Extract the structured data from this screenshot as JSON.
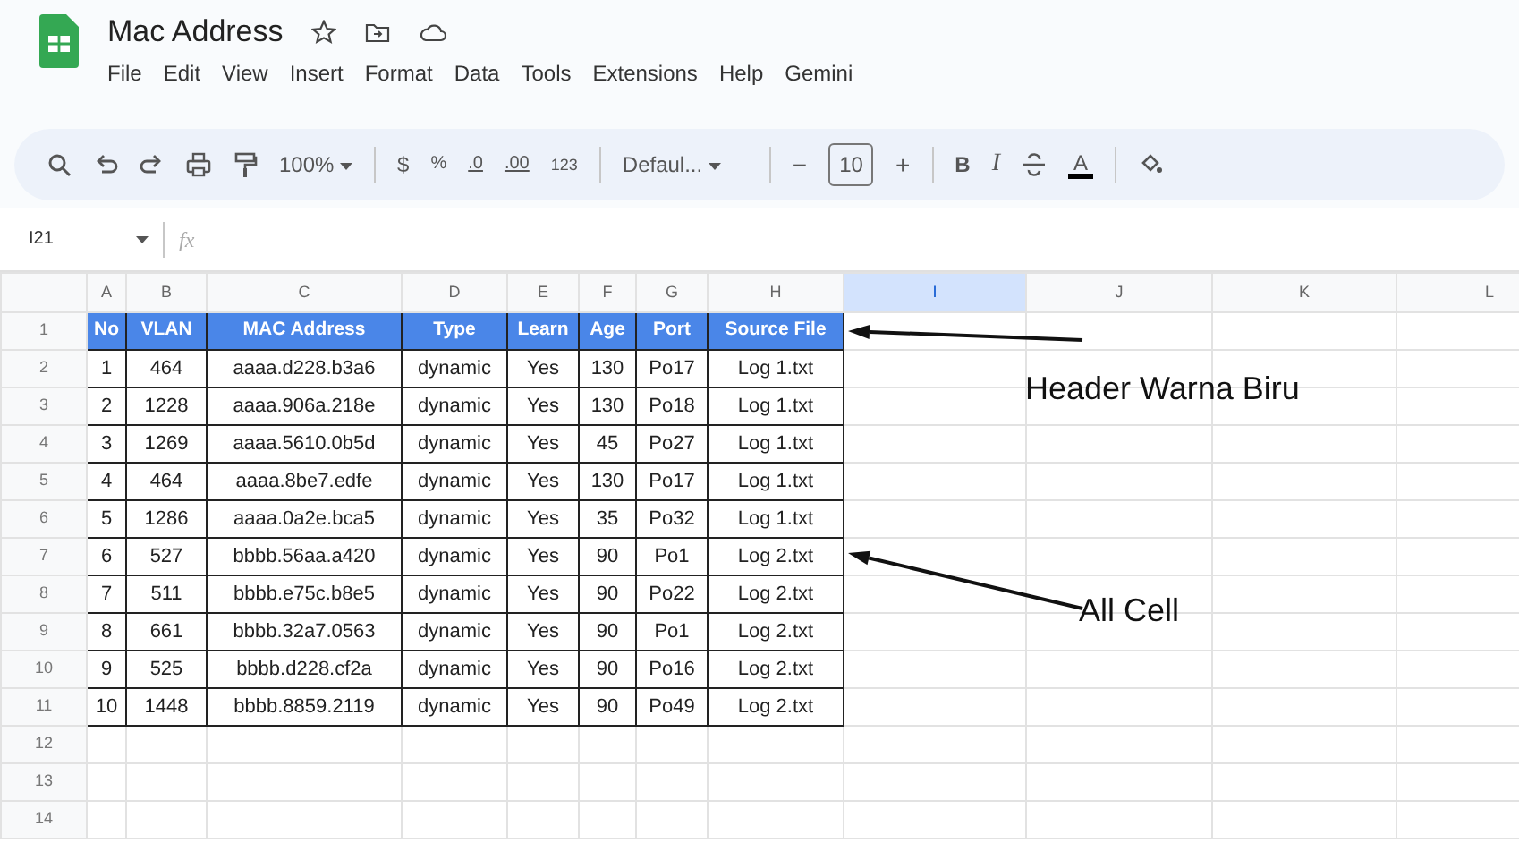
{
  "app": {
    "title": "Mac Address",
    "menu": [
      "File",
      "Edit",
      "View",
      "Insert",
      "Format",
      "Data",
      "Tools",
      "Extensions",
      "Help",
      "Gemini"
    ]
  },
  "toolbar": {
    "zoom": "100%",
    "currency": "$",
    "percent": "%",
    "decrease_decimal": ".0",
    "increase_decimal": ".00",
    "number_format": "123",
    "font": "Defaul...",
    "minus": "−",
    "font_size": "10",
    "plus": "+",
    "bold": "B",
    "italic": "I",
    "text_color": "A"
  },
  "formula_bar": {
    "cell_ref": "I21",
    "fx": "fx"
  },
  "sheet": {
    "columns": [
      {
        "label": "A",
        "selected": false
      },
      {
        "label": "B",
        "selected": false
      },
      {
        "label": "C",
        "selected": false
      },
      {
        "label": "D",
        "selected": false
      },
      {
        "label": "E",
        "selected": false
      },
      {
        "label": "F",
        "selected": false
      },
      {
        "label": "G",
        "selected": false
      },
      {
        "label": "H",
        "selected": false
      },
      {
        "label": "I",
        "selected": true
      },
      {
        "label": "J",
        "selected": false
      },
      {
        "label": "K",
        "selected": false
      },
      {
        "label": "L",
        "selected": false
      }
    ],
    "row_numbers": [
      "1",
      "2",
      "3",
      "4",
      "5",
      "6",
      "7",
      "8",
      "9",
      "10",
      "11",
      "12",
      "13",
      "14"
    ],
    "header": [
      "No",
      "VLAN",
      "MAC Address",
      "Type",
      "Learn",
      "Age",
      "Port",
      "Source File"
    ],
    "data": [
      [
        "1",
        "464",
        "aaaa.d228.b3a6",
        "dynamic",
        "Yes",
        "130",
        "Po17",
        "Log 1.txt"
      ],
      [
        "2",
        "1228",
        "aaaa.906a.218e",
        "dynamic",
        "Yes",
        "130",
        "Po18",
        "Log 1.txt"
      ],
      [
        "3",
        "1269",
        "aaaa.5610.0b5d",
        "dynamic",
        "Yes",
        "45",
        "Po27",
        "Log 1.txt"
      ],
      [
        "4",
        "464",
        "aaaa.8be7.edfe",
        "dynamic",
        "Yes",
        "130",
        "Po17",
        "Log 1.txt"
      ],
      [
        "5",
        "1286",
        "aaaa.0a2e.bca5",
        "dynamic",
        "Yes",
        "35",
        "Po32",
        "Log 1.txt"
      ],
      [
        "6",
        "527",
        "bbbb.56aa.a420",
        "dynamic",
        "Yes",
        "90",
        "Po1",
        "Log 2.txt"
      ],
      [
        "7",
        "511",
        "bbbb.e75c.b8e5",
        "dynamic",
        "Yes",
        "90",
        "Po22",
        "Log 2.txt"
      ],
      [
        "8",
        "661",
        "bbbb.32a7.0563",
        "dynamic",
        "Yes",
        "90",
        "Po1",
        "Log 2.txt"
      ],
      [
        "9",
        "525",
        "bbbb.d228.cf2a",
        "dynamic",
        "Yes",
        "90",
        "Po16",
        "Log 2.txt"
      ],
      [
        "10",
        "1448",
        "bbbb.8859.2119",
        "dynamic",
        "Yes",
        "90",
        "Po49",
        "Log 2.txt"
      ]
    ]
  },
  "annotations": [
    {
      "text": "Header Warna Biru"
    },
    {
      "text": "All Cell"
    }
  ]
}
